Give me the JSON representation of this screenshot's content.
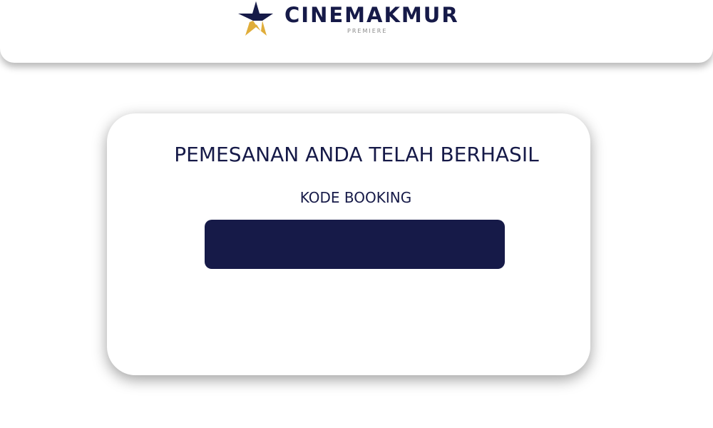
{
  "header": {
    "logo": {
      "wordmark": "CINEMAKMUR",
      "tagline": "PREMIERE",
      "icon": "star-logo-icon",
      "star_colors": {
        "navy": "#161a48",
        "gold": "#e0ad3a"
      }
    }
  },
  "confirmation": {
    "title": "PEMESANAN ANDA TELAH BERHASIL",
    "booking_label": "KODE BOOKING",
    "booking_code": ""
  },
  "colors": {
    "navy": "#161a48",
    "gold": "#e0ad3a",
    "background": "#ffffff",
    "tagline_gray": "#8a8a8a"
  }
}
